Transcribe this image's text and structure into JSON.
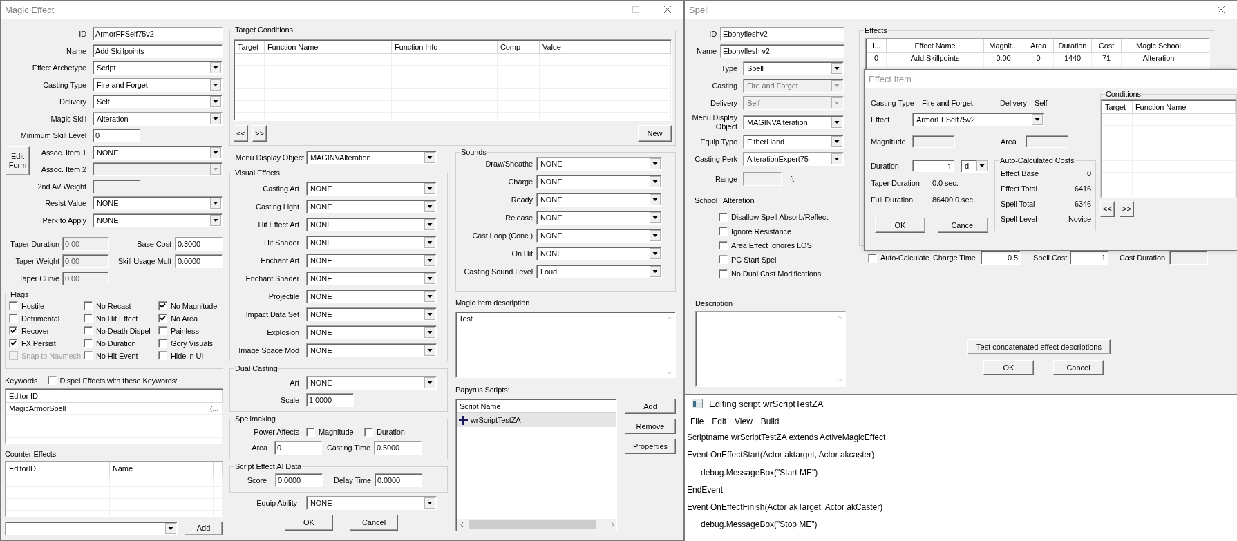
{
  "magic_effect": {
    "title": "Magic Effect",
    "fields": [
      {
        "label": "ID",
        "kind": "text",
        "value": "ArmorFFSelf75v2",
        "disabled": false
      },
      {
        "label": "Name",
        "kind": "text",
        "value": "Add Skillpoints",
        "disabled": false
      },
      {
        "label": "Effect Archetype",
        "kind": "combo",
        "value": "Script",
        "disabled": false
      },
      {
        "label": "Casting Type",
        "kind": "combo",
        "value": "Fire and Forget",
        "disabled": false
      },
      {
        "label": "Delivery",
        "kind": "combo",
        "value": "Self",
        "disabled": false
      },
      {
        "label": "Magic Skill",
        "kind": "combo",
        "value": "Alteration",
        "disabled": false
      },
      {
        "label": "Minimum Skill Level",
        "kind": "short",
        "value": "0",
        "disabled": false
      },
      {
        "label": "Assoc. Item 1",
        "kind": "combo",
        "value": "NONE",
        "disabled": false
      },
      {
        "label": "Assoc. Item 2",
        "kind": "combo",
        "disabled": true
      },
      {
        "label": "2nd AV Weight",
        "kind": "short",
        "disabled": true
      },
      {
        "label": "Resist Value",
        "kind": "combo",
        "value": "NONE",
        "disabled": false
      },
      {
        "label": "Perk to Apply",
        "kind": "combo",
        "value": "NONE",
        "disabled": false
      }
    ],
    "edit_form_button": "Edit Form",
    "taper": [
      {
        "label": "Taper Duration",
        "value": "0.00",
        "disabled": true
      },
      {
        "label": "Taper Weight",
        "value": "0.00",
        "disabled": true
      },
      {
        "label": "Taper Curve",
        "value": "0.00",
        "disabled": true
      }
    ],
    "costs": [
      {
        "label": "Base Cost",
        "value": "0.3000",
        "disabled": false
      },
      {
        "label": "Skill Usage Mult",
        "value": "0.0000",
        "disabled": false
      }
    ],
    "flags": {
      "title": "Flags",
      "items": [
        {
          "label": "Hostile",
          "checked": false,
          "disabled": false
        },
        {
          "label": "No Recast",
          "checked": false,
          "disabled": false
        },
        {
          "label": "No Magnitude",
          "checked": true,
          "disabled": false
        },
        {
          "label": "Detrimental",
          "checked": false,
          "disabled": false
        },
        {
          "label": "No Hit Effect",
          "checked": false,
          "disabled": false
        },
        {
          "label": "No Area",
          "checked": true,
          "disabled": false
        },
        {
          "label": "Recover",
          "checked": true,
          "disabled": false
        },
        {
          "label": "No Death Dispel",
          "checked": false,
          "disabled": false
        },
        {
          "label": "Painless",
          "checked": false,
          "disabled": false
        },
        {
          "label": "FX Persist",
          "checked": true,
          "disabled": false
        },
        {
          "label": "No Duration",
          "checked": false,
          "disabled": false
        },
        {
          "label": "Gory Visuals",
          "checked": false,
          "disabled": false
        },
        {
          "label": "Snap to Navmesh",
          "checked": false,
          "disabled": true
        },
        {
          "label": "No Hit Event",
          "checked": false,
          "disabled": false
        },
        {
          "label": "Hide in UI",
          "checked": false,
          "disabled": false
        }
      ]
    },
    "keywords": {
      "label": "Keywords",
      "dispel": {
        "label": "Dispel Effects with these Keywords:",
        "checked": false
      },
      "columns": [
        "Editor ID"
      ],
      "rows": [
        [
          "MagicArmorSpell",
          "(..."
        ]
      ]
    },
    "counter_effects": {
      "label": "Counter Effects",
      "columns": [
        "EditorID",
        "Name"
      ]
    },
    "add_button": "Add",
    "target_conditions": {
      "title": "Target Conditions",
      "columns": [
        "Target",
        "Function Name",
        "Function Info",
        "Comp",
        "Value"
      ],
      "prev": "<<",
      "next": ">>",
      "new": "New"
    },
    "menu_display_object": {
      "label": "Menu Display Object",
      "value": "MAGINVAlteration"
    },
    "visual_effects": {
      "title": "Visual Effects",
      "items": [
        {
          "label": "Casting Art",
          "value": "NONE"
        },
        {
          "label": "Casting Light",
          "value": "NONE"
        },
        {
          "label": "Hit Effect Art",
          "value": "NONE"
        },
        {
          "label": "Hit Shader",
          "value": "NONE"
        },
        {
          "label": "Enchant Art",
          "value": "NONE"
        },
        {
          "label": "Enchant Shader",
          "value": "NONE"
        },
        {
          "label": "Projectile",
          "value": "NONE"
        },
        {
          "label": "Impact Data Set",
          "value": "NONE"
        },
        {
          "label": "Explosion",
          "value": "NONE"
        },
        {
          "label": "Image Space Mod",
          "value": "NONE"
        }
      ]
    },
    "dual_casting": {
      "title": "Dual Casting",
      "art": {
        "label": "Art",
        "value": "NONE"
      },
      "scale": {
        "label": "Scale",
        "value": "1.0000"
      }
    },
    "spellmaking": {
      "title": "Spellmaking",
      "power_affects": "Power Affects",
      "options": [
        {
          "label": "Magnitude",
          "checked": false
        },
        {
          "label": "Duration",
          "checked": false
        }
      ],
      "area": {
        "label": "Area",
        "value": "0"
      },
      "casting_time": {
        "label": "Casting Time",
        "value": "0.5000"
      }
    },
    "script_ai": {
      "title": "Script Effect AI Data",
      "score": {
        "label": "Score",
        "value": "0.0000"
      },
      "delay_time": {
        "label": "Delay Time",
        "value": "0.0000"
      }
    },
    "equip_ability": {
      "label": "Equip Ability",
      "value": "NONE"
    },
    "buttons": [
      "OK",
      "Cancel"
    ],
    "sounds": {
      "title": "Sounds",
      "items": [
        {
          "label": "Draw/Sheathe",
          "value": "NONE"
        },
        {
          "label": "Charge",
          "value": "NONE"
        },
        {
          "label": "Ready",
          "value": "NONE"
        },
        {
          "label": "Release",
          "value": "NONE"
        },
        {
          "label": "Cast Loop (Conc.)",
          "value": "NONE"
        },
        {
          "label": "On Hit",
          "value": "NONE"
        },
        {
          "label": "Casting Sound Level",
          "value": "Loud"
        }
      ]
    },
    "description": {
      "label": "Magic item description",
      "value": "Test"
    },
    "papyrus": {
      "label": "Papyrus Scripts:",
      "columns": [
        "Script Name"
      ],
      "scripts": [
        {
          "name": "wrScriptTestZA",
          "selected": true
        }
      ],
      "buttons": [
        "Add",
        "Remove",
        "Properties"
      ]
    }
  },
  "spell": {
    "title": "Spell",
    "fields": [
      {
        "label": "ID",
        "kind": "text",
        "value": "Ebonyfleshv2",
        "disabled": false
      },
      {
        "label": "Name",
        "kind": "text",
        "value": "Ebonyflesh v2",
        "disabled": false
      },
      {
        "label": "Type",
        "kind": "combo",
        "value": "Spell",
        "disabled": false
      },
      {
        "label": "Casting",
        "kind": "combo",
        "value": "Fire and Forget",
        "disabled": true
      },
      {
        "label": "Delivery",
        "kind": "combo",
        "value": "Self",
        "disabled": true
      },
      {
        "label": "Menu Display Object",
        "kind": "combo",
        "value": "MAGINVAlteration",
        "disabled": false
      },
      {
        "label": "Equip Type",
        "kind": "combo",
        "value": "EitherHand",
        "disabled": false
      },
      {
        "label": "Casting Perk",
        "kind": "combo",
        "value": "AlterationExpert75",
        "disabled": false
      },
      {
        "label": "Range",
        "kind": "short",
        "disabled": true,
        "unit": "ft"
      }
    ],
    "school": {
      "label": "School",
      "value": "Alteration"
    },
    "options": [
      {
        "label": "Disallow Spell Absorb/Reflect",
        "checked": false
      },
      {
        "label": "Ignore Resistance",
        "checked": false
      },
      {
        "label": "Area Effect Ignores LOS",
        "checked": false
      },
      {
        "label": "PC Start Spell",
        "checked": false
      },
      {
        "label": "No Dual Cast Modifications",
        "checked": false
      }
    ],
    "description_label": "Description",
    "effects": {
      "title": "Effects",
      "columns": [
        "I...",
        "Effect Name",
        "Magnit...",
        "Area",
        "Duration",
        "Cost",
        "Magic School"
      ],
      "rows": [
        [
          "0",
          "Add Skillpoints",
          "0.00",
          "0",
          "1440",
          "71",
          "Alteration"
        ]
      ]
    },
    "auto_calculate": {
      "label": "Auto-Calculate",
      "checked": false
    },
    "charge_time": {
      "label": "Charge Time",
      "value": "0.5",
      "disabled": false
    },
    "spell_cost": {
      "label": "Spell Cost",
      "value": "1",
      "disabled": false
    },
    "cast_duration": {
      "label": "Cast Duration",
      "disabled": true
    },
    "test_button": "Test concatenated effect descriptions",
    "buttons": [
      "OK",
      "Cancel"
    ]
  },
  "effect_item": {
    "title": "Effect Item",
    "casting_type": {
      "label": "Casting Type",
      "value": "Fire and Forget"
    },
    "delivery": {
      "label": "Delivery",
      "value": "Self"
    },
    "effect": {
      "label": "Effect",
      "value": "ArmorFFSelf75v2"
    },
    "magnitude": {
      "label": "Magnitude",
      "disabled": true
    },
    "area": {
      "label": "Area",
      "disabled": true
    },
    "duration": {
      "label": "Duration",
      "value": "1",
      "unit": "d"
    },
    "taper_duration": {
      "label": "Taper Duration",
      "value": "0.0 sec."
    },
    "full_duration": {
      "label": "Full Duration",
      "value": "86400.0 sec."
    },
    "buttons": [
      "OK",
      "Cancel"
    ],
    "costs": {
      "title": "Auto-Calculated Costs",
      "rows": [
        {
          "label": "Effect Base",
          "value": "0"
        },
        {
          "label": "Effect Total",
          "value": "6416"
        },
        {
          "label": "Spell Total",
          "value": "6346"
        },
        {
          "label": "Spell Level",
          "value": "Novice"
        }
      ]
    },
    "conditions": {
      "title": "Conditions",
      "columns": [
        "Target",
        "Function Name"
      ],
      "prev": "<<",
      "next": ">>"
    }
  },
  "script_editor": {
    "title": "Editing script wrScriptTestZA",
    "menu": [
      "File",
      "Edit",
      "View",
      "Build"
    ],
    "lines": [
      {
        "kind": "line",
        "text": "Scriptname wrScriptTestZA extends ActiveMagicEffect"
      },
      {
        "kind": "line",
        "text": "Event OnEffectStart(Actor aktarget, Actor akcaster)"
      },
      {
        "kind": "indented",
        "text": "debug.MessageBox(\"Start ME\")"
      },
      {
        "kind": "line",
        "text": "EndEvent"
      },
      {
        "kind": "line",
        "text": "Event OnEffectFinish(Actor akTarget, Actor akCaster)"
      },
      {
        "kind": "indented",
        "text": "debug.MessageBox(\"Stop ME\")"
      }
    ]
  }
}
